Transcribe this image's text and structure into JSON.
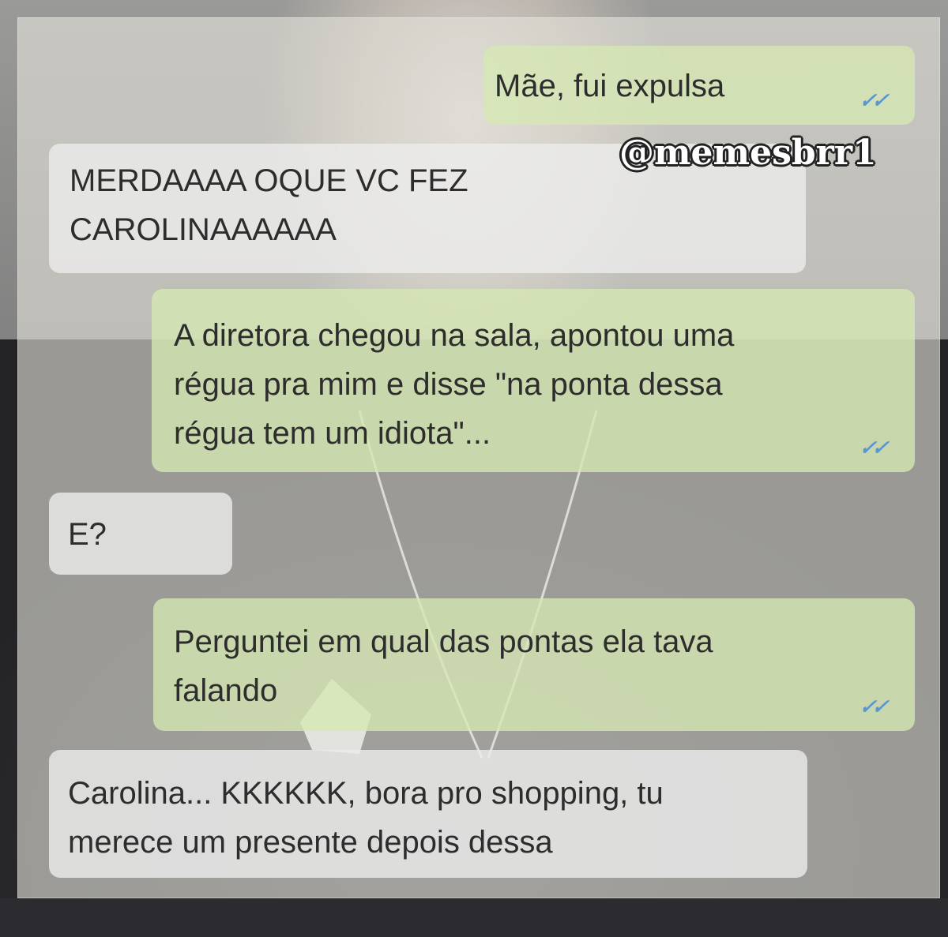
{
  "watermark": "@memesbrr1",
  "messages": [
    {
      "direction": "outgoing",
      "text": "Mãe, fui expulsa",
      "status": "read"
    },
    {
      "direction": "incoming",
      "text": "MERDAAAA OQUE VC FEZ\nCAROLINAAAAAA"
    },
    {
      "direction": "outgoing",
      "text": "A diretora chegou na sala, apontou uma\nrégua pra mim e disse \"na ponta dessa\nrégua tem um idiota\"...",
      "status": "read"
    },
    {
      "direction": "incoming",
      "text": "E?"
    },
    {
      "direction": "outgoing",
      "text": "Perguntei em qual das pontas ela tava\nfalando",
      "status": "read"
    },
    {
      "direction": "incoming",
      "text": "Carolina... KKKKKK, bora pro shopping, tu\nmerece um presente depois dessa"
    }
  ],
  "icons": {
    "read_receipt": "double-check-icon"
  },
  "colors": {
    "outgoing_bubble": "#d6e8b4",
    "incoming_bubble": "#ececec",
    "read_ticks": "#5a95d6"
  }
}
